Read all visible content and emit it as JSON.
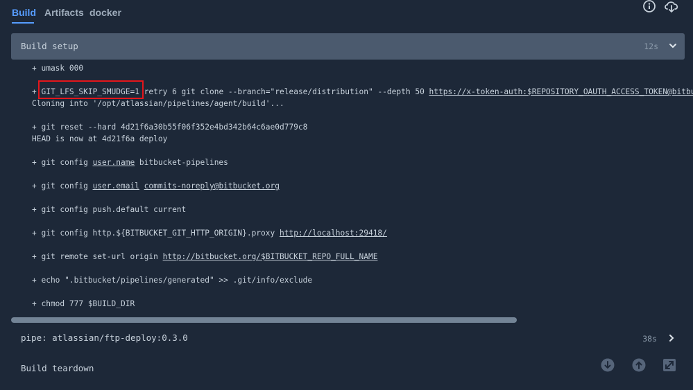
{
  "tabs": [
    {
      "label": "Build",
      "active": true
    },
    {
      "label": "Artifacts",
      "active": false
    },
    {
      "label": "docker",
      "active": false
    }
  ],
  "header_icons": [
    "info-icon",
    "cloud-download-icon"
  ],
  "step": {
    "title": "Build setup",
    "duration": "12s",
    "expanded": true
  },
  "log": {
    "l1": "+ umask 000",
    "l2_plus": "+ ",
    "l2_env": "GIT_LFS_SKIP_SMUDGE=1",
    "l2_cmd": " retry 6 git clone --branch=\"release/distribution\" --depth 50 ",
    "l2_url": "https://x-token-auth:$REPOSITORY_OAUTH_ACCESS_TOKEN@bitbucket.org/",
    "l3": "Cloning into '/opt/atlassian/pipelines/agent/build'...",
    "l4": "+ git reset --hard 4d21f6a30b55f06f352e4bd342b64c6ae0d779c8",
    "l5": "HEAD is now at 4d21f6a deploy",
    "l6_pre": "+ git config ",
    "l6_link": "user.name",
    "l6_post": " bitbucket-pipelines",
    "l7_pre": "+ git config ",
    "l7_link1": "user.email",
    "l7_link2": "commits-noreply@bitbucket.org",
    "l8": "+ git config push.default current",
    "l9_pre": "+ git config http.${BITBUCKET_GIT_HTTP_ORIGIN}.proxy ",
    "l9_link": "http://localhost:29418/",
    "l10_pre": "+ git remote set-url origin ",
    "l10_link": "http://bitbucket.org/$BITBUCKET_REPO_FULL_NAME",
    "l11": "+ echo \".bitbucket/pipelines/generated\" >> .git/info/exclude",
    "l12": "+ chmod 777 $BUILD_DIR"
  },
  "pipe_step": {
    "label": "pipe: atlassian/ftp-deploy:0.3.0",
    "duration": "38s"
  },
  "teardown_step": {
    "label": "Build teardown"
  },
  "bottom_icons": [
    "scroll-down-icon",
    "scroll-up-icon",
    "expand-icon"
  ],
  "colors": {
    "accent": "#579dff",
    "highlight_box": "#e5161b",
    "background": "#1d2838",
    "step_header": "#4b5a6e"
  }
}
